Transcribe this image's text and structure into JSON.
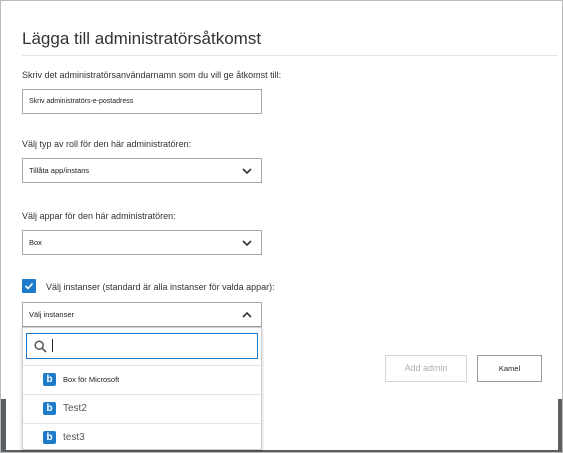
{
  "dialog": {
    "title": "Lägga till administratörsåtkomst",
    "username_label": "Skriv det administratörsanvändarnamn som du vill ge åtkomst till:",
    "username_placeholder": "Skriv  administratörs-e-postadress",
    "role_label": "Välj typ av roll för den här administratören:",
    "role_value": "Tillåta app/instans",
    "apps_label": "Välj appar för den här administratören:",
    "apps_value": "Box",
    "instances_checkbox_checked": true,
    "instances_label": "Välj instanser (standard är alla instanser för valda appar):",
    "instances_placeholder": "Välj instanser",
    "search_value": "",
    "instance_options": [
      {
        "label": "Box för Microsoft",
        "icon": "box-logo-icon"
      },
      {
        "label": "Test2",
        "icon": "box-logo-icon"
      },
      {
        "label": "test3",
        "icon": "box-logo-icon"
      }
    ],
    "add_button": "Add admin",
    "cancel_button": "Kamel"
  },
  "colors": {
    "accent": "#1e7bc9",
    "backdrop": "#5a5f63"
  }
}
